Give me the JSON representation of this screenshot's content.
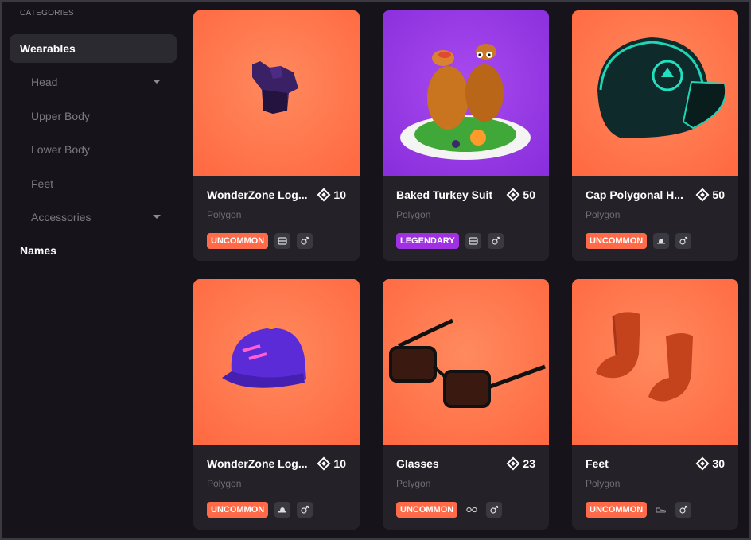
{
  "sidebar": {
    "header": "CATEGORIES",
    "items": [
      {
        "label": "Wearables",
        "active": true
      },
      {
        "label": "Head",
        "has_dropdown": true
      },
      {
        "label": "Upper Body"
      },
      {
        "label": "Lower Body"
      },
      {
        "label": "Feet"
      },
      {
        "label": "Accessories",
        "has_dropdown": true
      },
      {
        "label": "Names"
      }
    ]
  },
  "colors": {
    "background": "#16141a",
    "card": "#242228",
    "thumb_orange": "#ff7349",
    "thumb_purple": "#9a3de6",
    "uncommon": "#ff6b48",
    "legendary": "#a031e3"
  },
  "cards": [
    {
      "name": "WonderZone Log...",
      "price": "10",
      "network": "Polygon",
      "rarity": "UNCOMMON",
      "category_icon": "upper-body-icon",
      "gender_icon": "unisex-icon"
    },
    {
      "name": "Baked Turkey Suit",
      "price": "50",
      "network": "Polygon",
      "rarity": "LEGENDARY",
      "category_icon": "upper-body-icon",
      "gender_icon": "unisex-icon"
    },
    {
      "name": "Cap Polygonal H...",
      "price": "50",
      "network": "Polygon",
      "rarity": "UNCOMMON",
      "category_icon": "hat-icon",
      "gender_icon": "unisex-icon"
    },
    {
      "name": "WonderZone Log...",
      "price": "10",
      "network": "Polygon",
      "rarity": "UNCOMMON",
      "category_icon": "hat-icon",
      "gender_icon": "unisex-icon"
    },
    {
      "name": "Glasses",
      "price": "23",
      "network": "Polygon",
      "rarity": "UNCOMMON",
      "category_icon": "glasses-icon",
      "gender_icon": "unisex-icon"
    },
    {
      "name": "Feet",
      "price": "30",
      "network": "Polygon",
      "rarity": "UNCOMMON",
      "category_icon": "shoes-icon",
      "gender_icon": "unisex-icon"
    }
  ]
}
